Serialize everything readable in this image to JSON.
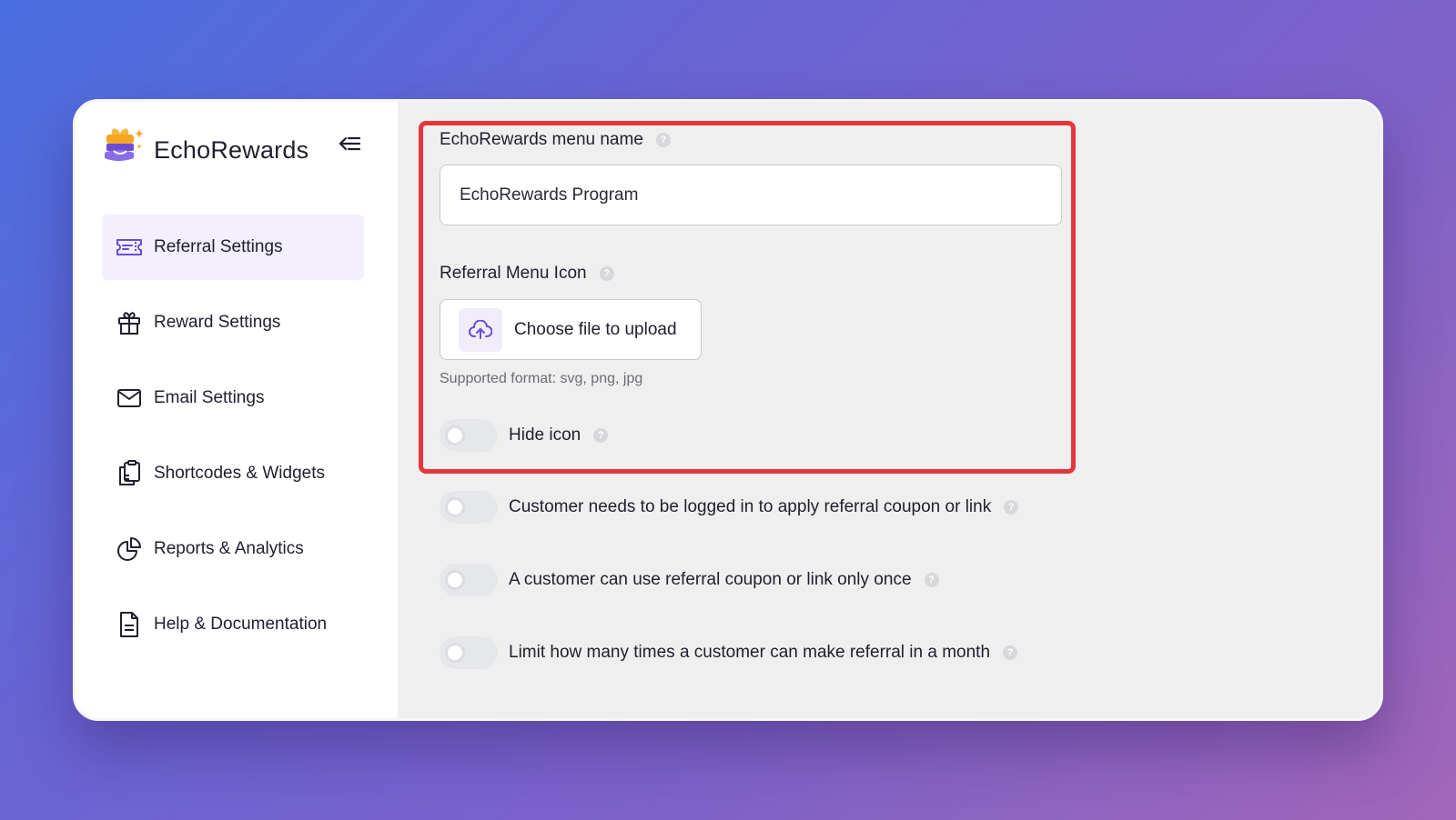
{
  "brand": {
    "name": "EchoRewards"
  },
  "sidebar": {
    "items": [
      {
        "label": "Referral Settings",
        "icon": "ticket-icon",
        "active": true
      },
      {
        "label": "Reward Settings",
        "icon": "gift-icon",
        "active": false
      },
      {
        "label": "Email Settings",
        "icon": "envelope-icon",
        "active": false
      },
      {
        "label": "Shortcodes & Widgets",
        "icon": "clipboard-icon",
        "active": false
      },
      {
        "label": "Reports & Analytics",
        "icon": "pie-chart-icon",
        "active": false
      },
      {
        "label": "Help & Documentation",
        "icon": "document-icon",
        "active": false
      }
    ]
  },
  "form": {
    "menu_name_label": "EchoRewards menu name",
    "menu_name_value": "EchoRewards Program",
    "menu_icon_label": "Referral Menu Icon",
    "upload_label": "Choose file to upload",
    "upload_hint": "Supported format: svg, png, jpg",
    "toggles": [
      {
        "label": "Hide icon",
        "on": false
      },
      {
        "label": "Customer needs to be logged in to apply referral coupon or link",
        "on": false
      },
      {
        "label": "A customer can use referral coupon or link only once",
        "on": false
      },
      {
        "label": "Limit how many times a customer can make referral in a month",
        "on": false
      }
    ],
    "help_glyph": "?"
  },
  "colors": {
    "accent": "#6a4cd8",
    "highlight_border": "#e8353d",
    "active_nav_bg": "#f3effd"
  }
}
